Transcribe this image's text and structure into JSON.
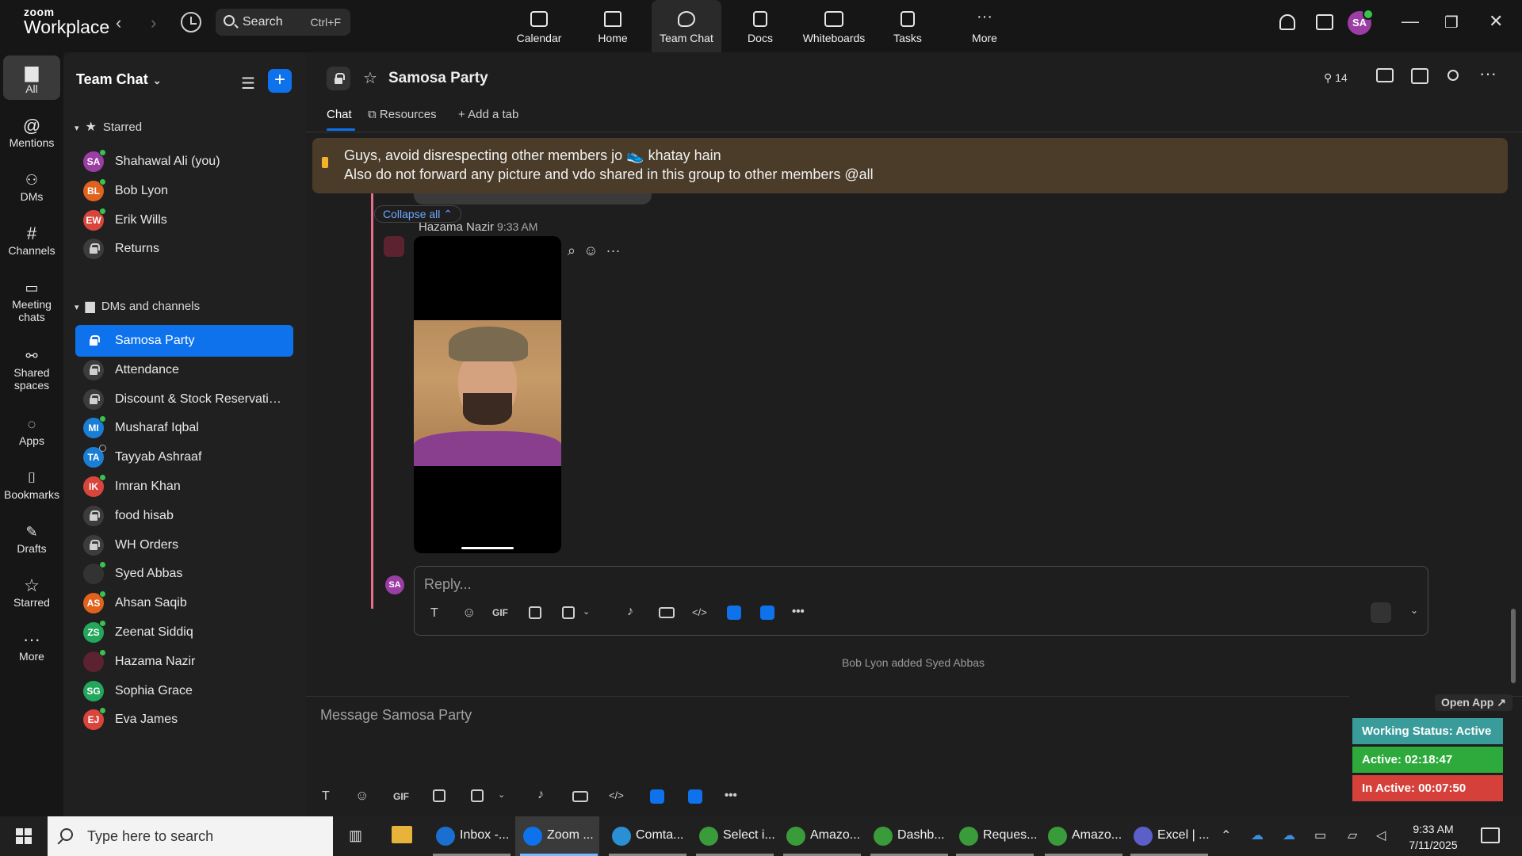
{
  "topbar": {
    "brand_top": "zoom",
    "brand_bottom": "Workplace",
    "search_label": "Search",
    "search_shortcut": "Ctrl+F",
    "nav": [
      {
        "label": "Calendar",
        "icon": "calendar-icon"
      },
      {
        "label": "Home",
        "icon": "home-icon"
      },
      {
        "label": "Team Chat",
        "icon": "chat-icon"
      },
      {
        "label": "Docs",
        "icon": "docs-icon"
      },
      {
        "label": "Whiteboards",
        "icon": "whiteboard-icon"
      },
      {
        "label": "Tasks",
        "icon": "tasks-icon"
      },
      {
        "label": "More",
        "icon": "more-icon"
      }
    ],
    "active_nav": "Team Chat",
    "avatar_initials": "SA"
  },
  "rail": [
    {
      "label": "All",
      "icon": "chat-bubble-icon"
    },
    {
      "label": "Mentions",
      "icon": "at-icon"
    },
    {
      "label": "DMs",
      "icon": "people-icon"
    },
    {
      "label": "Channels",
      "icon": "hash-icon"
    },
    {
      "label": "Meeting",
      "label2": "chats",
      "icon": "meeting-icon"
    },
    {
      "label": "Shared",
      "label2": "spaces",
      "icon": "shared-icon"
    },
    {
      "label": "Apps",
      "icon": "apps-icon"
    },
    {
      "label": "Bookmarks",
      "icon": "bookmark-icon"
    },
    {
      "label": "Drafts",
      "icon": "drafts-icon"
    },
    {
      "label": "Starred",
      "icon": "star-icon"
    },
    {
      "label": "More",
      "icon": "more-icon"
    }
  ],
  "sidebar": {
    "title": "Team Chat",
    "sections": {
      "starred": "Starred",
      "dms": "DMs and channels"
    },
    "starred": [
      {
        "name": "Shahawal Ali (you)",
        "initials": "SA",
        "color": "#9b3ea4",
        "status": "on"
      },
      {
        "name": "Bob Lyon",
        "initials": "BL",
        "color": "#e0621d",
        "status": "on"
      },
      {
        "name": "Erik Wills",
        "initials": "EW",
        "color": "#d9453b",
        "status": "on"
      },
      {
        "name": "Returns",
        "initials": "",
        "color": "",
        "status": "lock"
      }
    ],
    "dms": [
      {
        "name": "Samosa Party",
        "initials": "",
        "color": "",
        "status": "lock",
        "active": true
      },
      {
        "name": "Attendance",
        "initials": "",
        "color": "",
        "status": "lock"
      },
      {
        "name": "Discount & Stock Reservatio...",
        "initials": "",
        "color": "",
        "status": "lock"
      },
      {
        "name": "Musharaf Iqbal",
        "initials": "MI",
        "color": "#1a7fd4",
        "status": "on"
      },
      {
        "name": "Tayyab Ashraaf",
        "initials": "TA",
        "color": "#1a7fd4",
        "status": "off"
      },
      {
        "name": "Imran Khan",
        "initials": "IK",
        "color": "#d9453b",
        "status": "on"
      },
      {
        "name": "food hisab",
        "initials": "",
        "color": "",
        "status": "lock"
      },
      {
        "name": "WH Orders",
        "initials": "",
        "color": "",
        "status": "lock"
      },
      {
        "name": "Syed Abbas",
        "initials": "",
        "color": "#333333",
        "status": "on"
      },
      {
        "name": "Ahsan Saqib",
        "initials": "AS",
        "color": "#e0621d",
        "status": "on"
      },
      {
        "name": "Zeenat Siddiq",
        "initials": "ZS",
        "color": "#23a75b",
        "status": "on"
      },
      {
        "name": "Hazama Nazir",
        "initials": "",
        "color": "#5c2230",
        "status": "on"
      },
      {
        "name": "Sophia Grace",
        "initials": "SG",
        "color": "#23a75b",
        "status": "none"
      },
      {
        "name": "Eva James",
        "initials": "EJ",
        "color": "#d9453b",
        "status": "on"
      }
    ]
  },
  "channel": {
    "name": "Samosa Party",
    "member_count": "14",
    "tabs": [
      "Chat",
      "Resources",
      "+ Add a tab"
    ],
    "pinned_line1": "Guys, avoid disrespecting other members jo 👟 khatay hain",
    "pinned_line2": "Also do not forward any picture and vdo shared in this group to other members @all",
    "collapse_label": "Collapse all ⌃",
    "message": {
      "sender": "Hazama Nazir",
      "time": "9:33 AM"
    },
    "reply_avatar": "SA",
    "reply_placeholder": "Reply...",
    "system_message": "Bob Lyon added Syed Abbas",
    "composer_placeholder": "Message Samosa Party",
    "toolbar": {
      "gif": "GIF",
      "text": "T",
      "code": "</>",
      "more": "•••"
    }
  },
  "widget": {
    "open_app": "Open App ↗",
    "working_status": "Working Status: Active",
    "active": "Active: 02:18:47",
    "inactive": "In Active: 00:07:50",
    "colors": {
      "working": "#3a9c9a",
      "active": "#2eaa3c",
      "inactive": "#d6403b"
    }
  },
  "taskbar": {
    "search_placeholder": "Type here to search",
    "apps": [
      {
        "label": "Inbox -...",
        "color": "#1a6fd0"
      },
      {
        "label": "Zoom ...",
        "color": "#0e72ed",
        "active": true
      },
      {
        "label": "Comta...",
        "color": "#2b8fd6"
      },
      {
        "label": "Select i...",
        "color": "#3a9b3a"
      },
      {
        "label": "Amazo...",
        "color": "#3a9b3a"
      },
      {
        "label": "Dashb...",
        "color": "#3a9b3a"
      },
      {
        "label": "Reques...",
        "color": "#3a9b3a"
      },
      {
        "label": "Amazo...",
        "color": "#3a9b3a"
      },
      {
        "label": "Excel | ...",
        "color": "#5b5fc7"
      }
    ],
    "time": "9:33 AM",
    "date": "7/11/2025"
  }
}
